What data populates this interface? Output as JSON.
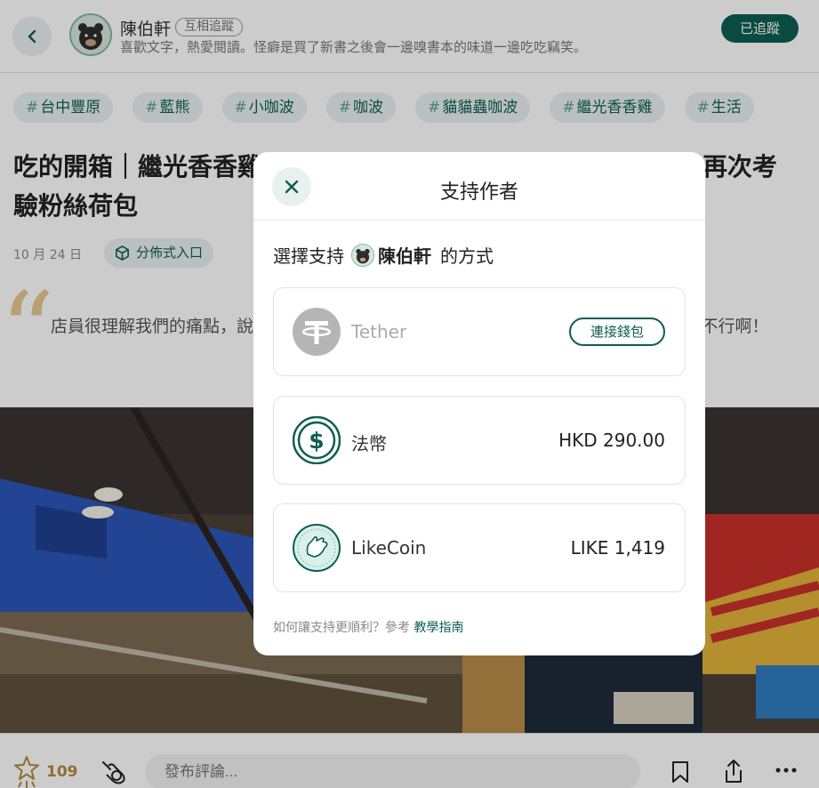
{
  "header": {
    "author_name": "陳伯軒",
    "mutual_badge": "互相追蹤",
    "author_bio": "喜歡文字，熱愛閱讀。怪癖是買了新書之後會一邊嗅書本的味道一邊吃吃竊笑。",
    "follow_label": "已追蹤"
  },
  "tags": [
    "台中豐原",
    "藍熊",
    "小咖波",
    "咖波",
    "貓貓蟲咖波",
    "繼光香香雞",
    "生活"
  ],
  "article": {
    "title": "吃的開箱｜繼光香香雞×貓貓蟲咖波×藍熊聯名｜可愛聯名商品再次考驗粉絲荷包",
    "date": "10 月 24 日",
    "ipfs_label": "分佈式入口",
    "quote": "店員很理解我們的痛點，說：「沒關係，要是還有什麼缺的，我可以立刻拿給你～」不買不行啊！"
  },
  "bottom_bar": {
    "like_count": "109",
    "comment_placeholder": "發布評論..."
  },
  "modal": {
    "title": "支持作者",
    "choose_prefix": "選擇支持",
    "choose_name": "陳伯軒",
    "choose_suffix": "的方式",
    "options": [
      {
        "name": "Tether",
        "action": "連接錢包",
        "disabled": true,
        "icon": "tether-icon"
      },
      {
        "name": "法幣",
        "value": "HKD 290.00",
        "icon": "dollar-icon"
      },
      {
        "name": "LikeCoin",
        "value": "LIKE 1,419",
        "icon": "likecoin-icon"
      }
    ],
    "help_text": "如何讓支持更順利？參考",
    "help_link": "教學指南"
  },
  "colors": {
    "accent": "#0d5e52",
    "accent_light": "#e9f1ef",
    "like_gold": "#b58a3c",
    "overlay": "rgba(0,0,0,0.2)"
  }
}
